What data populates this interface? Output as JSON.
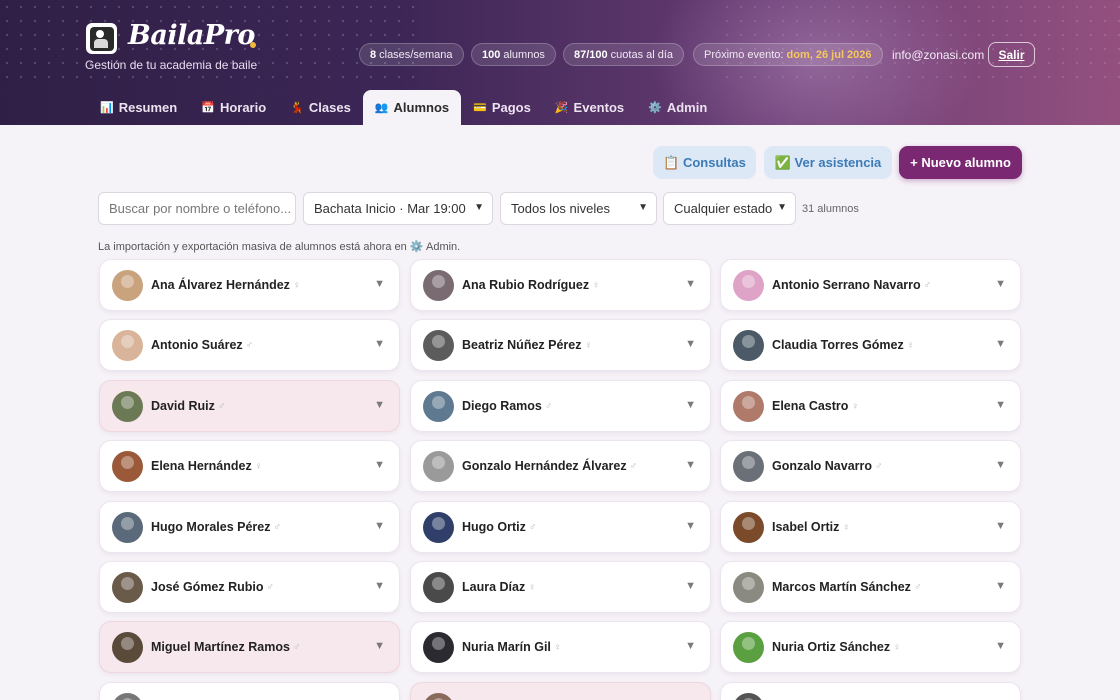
{
  "brand": {
    "name": "BailaPro",
    "tagline": "Gestión de tu academia de baile"
  },
  "stats": [
    {
      "value": "8",
      "label": "clases/semana"
    },
    {
      "value": "100",
      "label": "alumnos"
    },
    {
      "value": "87/100",
      "label": "cuotas al día"
    }
  ],
  "event": {
    "label": "Próximo evento:",
    "value": "dom, 26 jul 2026"
  },
  "user": {
    "email": "info@zonasi.com",
    "logout": "Salir"
  },
  "tabs": [
    {
      "icon": "📊",
      "label": "Resumen"
    },
    {
      "icon": "📅",
      "label": "Horario"
    },
    {
      "icon": "💃",
      "label": "Clases"
    },
    {
      "icon": "👥",
      "label": "Alumnos"
    },
    {
      "icon": "💳",
      "label": "Pagos"
    },
    {
      "icon": "🎉",
      "label": "Eventos"
    },
    {
      "icon": "⚙️",
      "label": "Admin"
    }
  ],
  "actions": {
    "consultas": "📋 Consultas",
    "asistencia": "✅ Ver asistencia",
    "nuevo": "+ Nuevo alumno"
  },
  "filters": {
    "search_placeholder": "Buscar por nombre o teléfono...",
    "clase": "Bachata Inicio · Mar 19:00",
    "nivel": "Todos los niveles",
    "estado": "Cualquier estado",
    "count": "31 alumnos"
  },
  "notice": "La importación y exportación masiva de alumnos está ahora en ⚙️ Admin.",
  "students": [
    {
      "name": "Ana Álvarez Hernández",
      "gender": "♀",
      "highlight": false,
      "avatar_color": "#c9a27e"
    },
    {
      "name": "Ana Rubio Rodríguez",
      "gender": "♀",
      "highlight": false,
      "avatar_color": "#7a6a72"
    },
    {
      "name": "Antonio Serrano Navarro",
      "gender": "♂",
      "highlight": false,
      "avatar_color": "#e0a3c8"
    },
    {
      "name": "Antonio Suárez",
      "gender": "♂",
      "highlight": false,
      "avatar_color": "#d9b49a"
    },
    {
      "name": "Beatriz Núñez Pérez",
      "gender": "♀",
      "highlight": false,
      "avatar_color": "#5c5c5c"
    },
    {
      "name": "Claudia Torres Gómez",
      "gender": "♀",
      "highlight": false,
      "avatar_color": "#4b5a66"
    },
    {
      "name": "David Ruiz",
      "gender": "♂",
      "highlight": true,
      "avatar_color": "#6b7a55"
    },
    {
      "name": "Diego Ramos",
      "gender": "♂",
      "highlight": false,
      "avatar_color": "#5f7a90"
    },
    {
      "name": "Elena Castro",
      "gender": "♀",
      "highlight": false,
      "avatar_color": "#b07a6a"
    },
    {
      "name": "Elena Hernández",
      "gender": "♀",
      "highlight": false,
      "avatar_color": "#9a5a3a"
    },
    {
      "name": "Gonzalo Hernández Álvarez",
      "gender": "♂",
      "highlight": false,
      "avatar_color": "#9a9a9a"
    },
    {
      "name": "Gonzalo Navarro",
      "gender": "♂",
      "highlight": false,
      "avatar_color": "#6a6f78"
    },
    {
      "name": "Hugo Morales Pérez",
      "gender": "♂",
      "highlight": false,
      "avatar_color": "#5a6a7a"
    },
    {
      "name": "Hugo Ortiz",
      "gender": "♂",
      "highlight": false,
      "avatar_color": "#2f3f6a"
    },
    {
      "name": "Isabel Ortiz",
      "gender": "♀",
      "highlight": false,
      "avatar_color": "#7a4a2a"
    },
    {
      "name": "José Gómez Rubio",
      "gender": "♂",
      "highlight": false,
      "avatar_color": "#6a5a4a"
    },
    {
      "name": "Laura Díaz",
      "gender": "♀",
      "highlight": false,
      "avatar_color": "#4a4a4a"
    },
    {
      "name": "Marcos Martín Sánchez",
      "gender": "♂",
      "highlight": false,
      "avatar_color": "#8a8a80"
    },
    {
      "name": "Miguel Martínez Ramos",
      "gender": "♂",
      "highlight": true,
      "avatar_color": "#5a4a3a"
    },
    {
      "name": "Nuria Marín Gil",
      "gender": "♀",
      "highlight": false,
      "avatar_color": "#2a2a30"
    },
    {
      "name": "Nuria Ortiz Sánchez",
      "gender": "♀",
      "highlight": false,
      "avatar_color": "#5aa040"
    },
    {
      "name": "",
      "gender": "",
      "highlight": false,
      "avatar_color": "#777777"
    },
    {
      "name": "",
      "gender": "",
      "highlight": true,
      "avatar_color": "#8a6a5a"
    },
    {
      "name": "",
      "gender": "",
      "highlight": false,
      "avatar_color": "#555555"
    }
  ]
}
